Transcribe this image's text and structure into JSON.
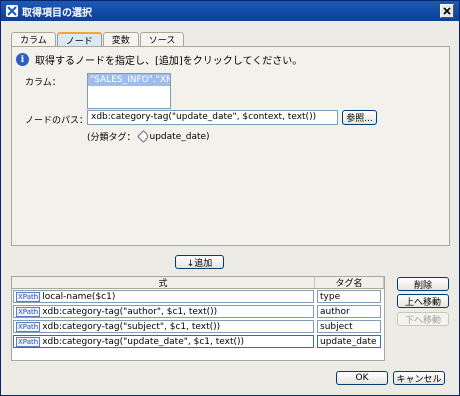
{
  "window": {
    "title": "取得項目の選択"
  },
  "tabs": [
    {
      "label": "カラム",
      "active": false
    },
    {
      "label": "ノード",
      "active": true
    },
    {
      "label": "変数",
      "active": false
    },
    {
      "label": "ソース",
      "active": false
    }
  ],
  "node_panel": {
    "instruction": "取得するノードを指定し、[追加]をクリックしてください。",
    "column_label": "カラム：",
    "column_items": [
      "\"SALES_INFO\".\"XML\""
    ],
    "path_label": "ノードのパス：",
    "path_value": "xdb:category-tag(\"update_date\", $context, text())",
    "browse_button": "参照...",
    "tag_prefix": "(分類タグ：",
    "tag_name": "update_date",
    "tag_suffix": ")"
  },
  "add_button": "↓追加",
  "table": {
    "headers": [
      "式",
      "タグ名"
    ],
    "rows": [
      {
        "badge": "XPath",
        "expression": "local-name($c1)",
        "tag": "type"
      },
      {
        "badge": "XPath",
        "expression": "xdb:category-tag(\"author\", $c1, text())",
        "tag": "author"
      },
      {
        "badge": "XPath",
        "expression": "xdb:category-tag(\"subject\", $c1, text())",
        "tag": "subject"
      },
      {
        "badge": "XPath",
        "expression": "xdb:category-tag(\"update_date\", $c1, text())",
        "tag": "update_date"
      }
    ]
  },
  "side_buttons": {
    "delete": "削除",
    "move_up": "上へ移動",
    "move_down": "下へ移動"
  },
  "footer": {
    "ok": "OK",
    "cancel": "キャンセル"
  }
}
